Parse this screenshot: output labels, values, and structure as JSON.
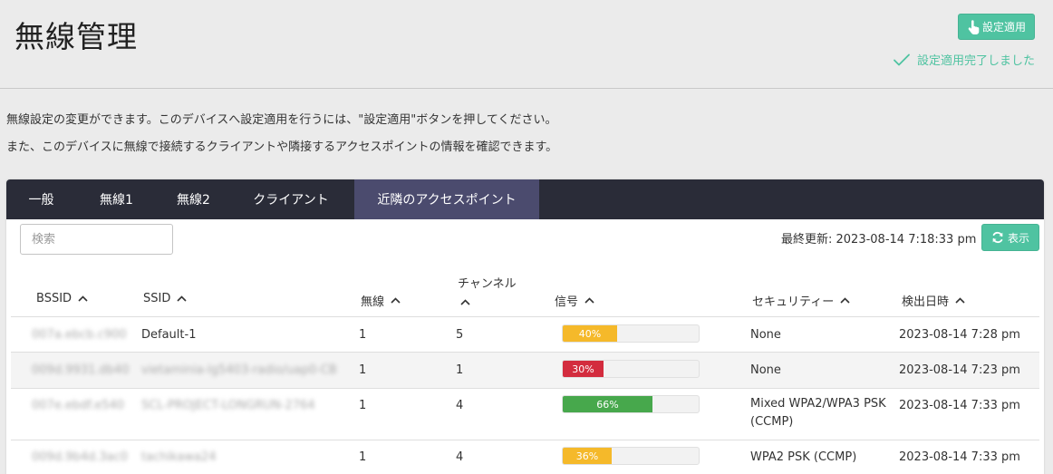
{
  "header": {
    "title": "無線管理",
    "apply_button_label": "設定適用",
    "apply_status": "設定適用完了しました"
  },
  "description": {
    "line1": "無線設定の変更ができます。このデバイスへ設定適用を行うには、\"設定適用\"ボタンを押してください。",
    "line2": "また、このデバイスに無線で接続するクライアントや隣接するアクセスポイントの情報を確認できます。"
  },
  "tabs": [
    {
      "label": "一般",
      "active": false
    },
    {
      "label": "無線1",
      "active": false
    },
    {
      "label": "無線2",
      "active": false
    },
    {
      "label": "クライアント",
      "active": false
    },
    {
      "label": "近隣のアクセスポイント",
      "active": true
    }
  ],
  "search": {
    "placeholder": "検索",
    "value": ""
  },
  "last_updated": "最終更新: 2023-08-14 7:18:33 pm",
  "refresh_button_label": "表示",
  "columns": {
    "bssid": "BSSID",
    "ssid": "SSID",
    "radio": "無線",
    "channel": "チャンネル",
    "signal": "信号",
    "security": "セキュリティー",
    "detected": "検出日時"
  },
  "rows": [
    {
      "bssid": "007a.ebcb.c900",
      "ssid": "Default-1",
      "radio": "1",
      "channel": "5",
      "signal_text": "40%",
      "signal": 40,
      "signal_color": "#f5b92a",
      "security": "None",
      "detected": "2023-08-14 7:28 pm"
    },
    {
      "bssid": "009d.9931.db40",
      "ssid": "vietaminia-lg5403-radio/uap0-CB",
      "radio": "1",
      "channel": "1",
      "signal_text": "30%",
      "signal": 30,
      "signal_color": "#d32c3e",
      "security": "None",
      "detected": "2023-08-14 7:23 pm"
    },
    {
      "bssid": "007e.ebdf.e540",
      "ssid": "SCL-PROJECT-LONGRUN-2764",
      "radio": "1",
      "channel": "4",
      "signal_text": "66%",
      "signal": 66,
      "signal_color": "#47a84c",
      "security": "Mixed WPA2/WPA3 PSK (CCMP)",
      "detected": "2023-08-14 7:33 pm"
    },
    {
      "bssid": "009d.9b4d.3ac0",
      "ssid": "tachikawa24",
      "radio": "1",
      "channel": "4",
      "signal_text": "36%",
      "signal": 36,
      "signal_color": "#f5b92a",
      "security": "WPA2 PSK (CCMP)",
      "detected": "2023-08-14 7:33 pm"
    }
  ]
}
